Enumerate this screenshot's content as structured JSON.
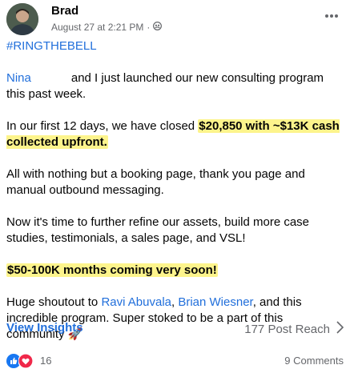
{
  "post": {
    "author": "Brad",
    "timestamp": "August 27 at 2:21 PM",
    "separator": "·",
    "privacy_icon": "group-privacy-icon",
    "hashtag": "#RINGTHEBELL",
    "mention_nina": "Nina",
    "para1_rest": "and I just launched our new consulting program this past week.",
    "para2_pre": "In our first 12 days, we have closed",
    "para2_highlight": "$20,850 with ~$13K cash collected upfront.",
    "para3": "All with nothing but a booking page, thank you page and manual outbound messaging.",
    "para4": "Now it's time to further refine our assets, build more case studies, testimonials, a sales page, and VSL!",
    "para5_highlight": "$50-100K months coming very soon!",
    "para6_pre": "Huge shoutout to",
    "mention_ravi": "Ravi Abuvala",
    "para6_comma": ",",
    "mention_brian": "Brian Wiesner",
    "para6_post": ", and this incredible program. Super stoked to be a part of this community",
    "rocket_emoji": "🚀"
  },
  "insights": {
    "view_label": "View Insights",
    "reach_label": "177 Post Reach",
    "chevron_icon": "chevron-right-icon"
  },
  "footer": {
    "reaction_count": "16",
    "comments_label": "9 Comments",
    "colors": {
      "like": "#1877f2",
      "love": "#f0284a",
      "link": "#216fdb",
      "highlight": "#fdf48c"
    }
  }
}
